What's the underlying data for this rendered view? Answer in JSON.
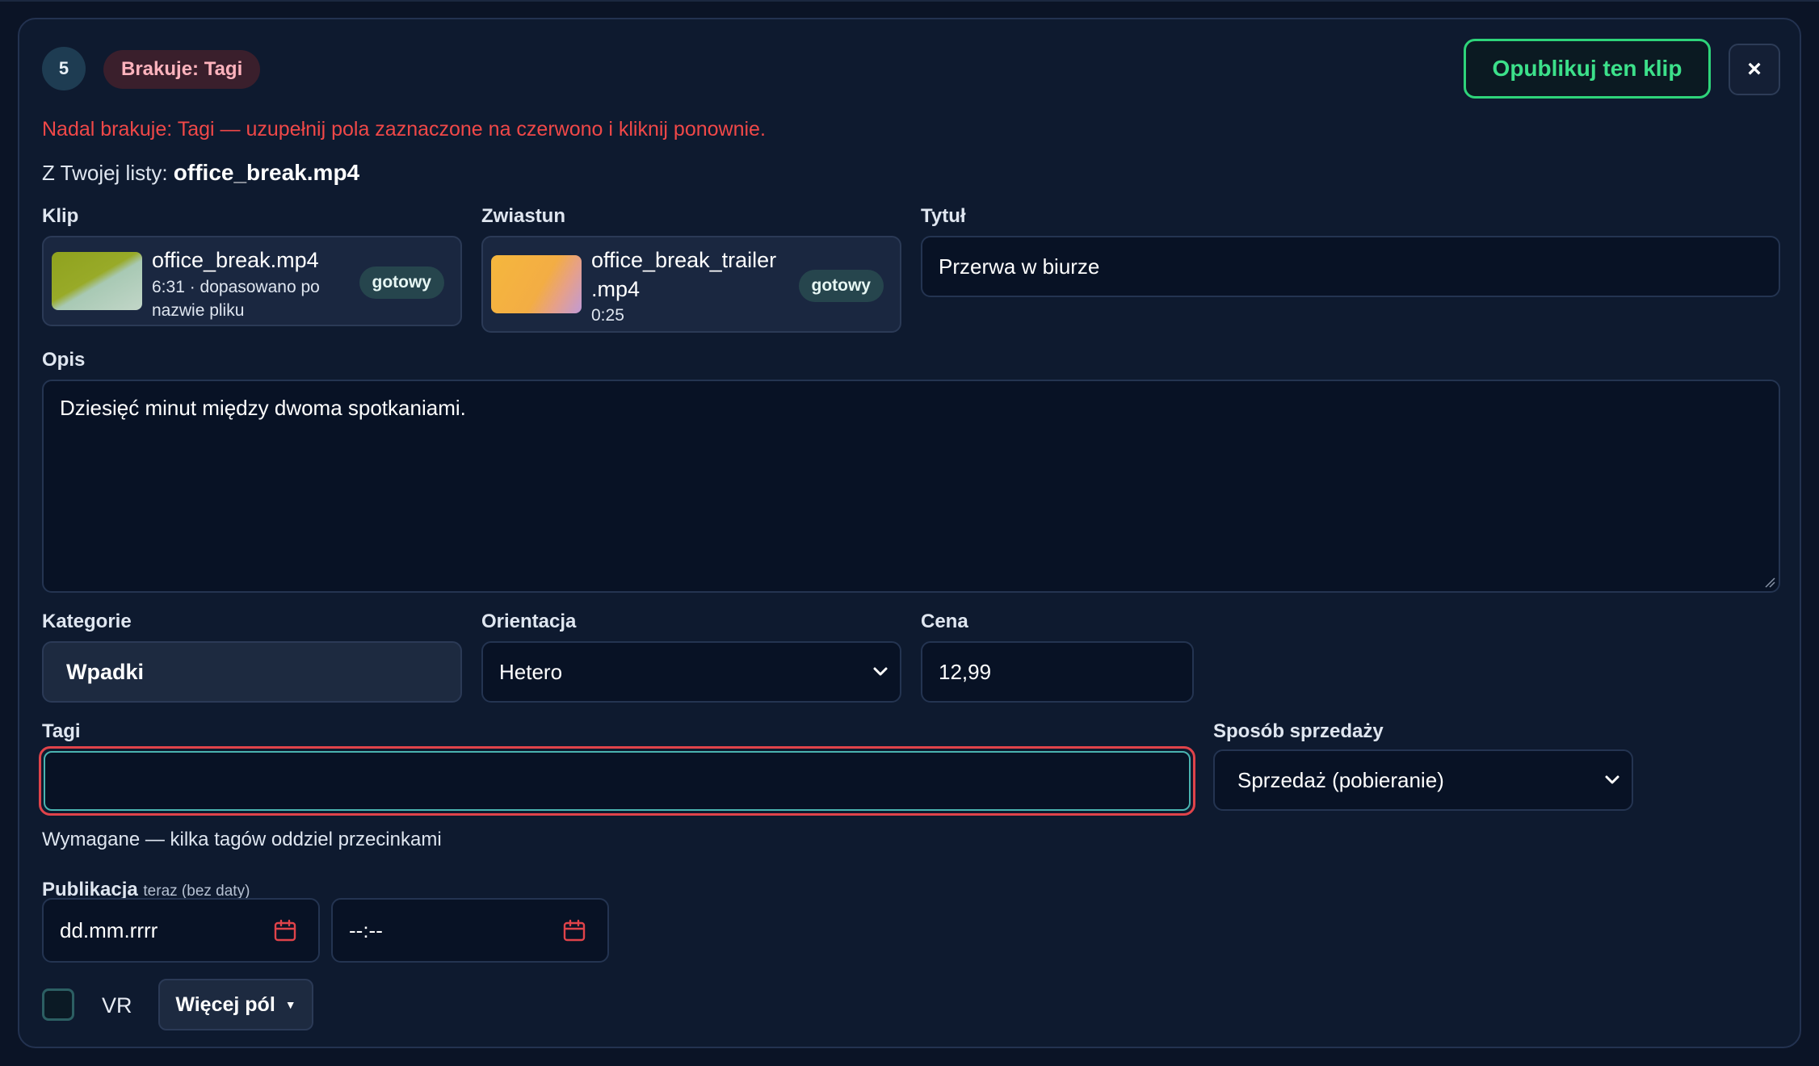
{
  "item": {
    "number": "5",
    "missing_badge": "Brakuje: Tagi"
  },
  "actions": {
    "publish_label": "Opublikuj ten klip",
    "close_label": "×"
  },
  "error_message": "Nadal brakuje: Tagi — uzupełnij pola zaznaczone na czerwono i kliknij ponownie.",
  "source": {
    "prefix": "Z Twojej listy:",
    "filename": "office_break.mp4"
  },
  "clip": {
    "label": "Klip",
    "filename": "office_break.mp4",
    "meta_line1": "6:31 · dopasowano po",
    "meta_line2": "nazwie pliku",
    "status": "gotowy"
  },
  "trailer": {
    "label": "Zwiastun",
    "filename_line1": "office_break_trailer",
    "filename_line2": ".mp4",
    "duration": "0:25",
    "status": "gotowy"
  },
  "title_field": {
    "label": "Tytuł",
    "value": "Przerwa w biurze"
  },
  "description_field": {
    "label": "Opis",
    "value": "Dziesięć minut między dwoma spotkaniami."
  },
  "categories_field": {
    "label": "Kategorie",
    "value": "Wpadki"
  },
  "orientation_field": {
    "label": "Orientacja",
    "selected": "Hetero"
  },
  "price_field": {
    "label": "Cena",
    "value": "12,99"
  },
  "tags_field": {
    "label": "Tagi",
    "value": "",
    "hint": "Wymagane — kilka tagów oddziel przecinkami"
  },
  "sale_mode_field": {
    "label": "Sposób sprzedaży",
    "selected": "Sprzedaż (pobieranie)"
  },
  "publication": {
    "label": "Publikacja",
    "sublabel": "teraz (bez daty)",
    "date_placeholder": "dd.mm.rrrr",
    "time_placeholder": "--:--"
  },
  "vr": {
    "label": "VR",
    "checked": false
  },
  "more_fields": {
    "label": "Więcej pól",
    "caret": "▼"
  },
  "colors": {
    "background": "#0b1426",
    "card": "#0e1a2f",
    "accent_green": "#2ed47a",
    "error_red": "#f04848",
    "tag_badge_bg": "#3a1f2c",
    "ready_pill_bg": "#26454d",
    "icon_red": "#e0434a"
  },
  "icons": {
    "calendar": "calendar-icon",
    "chevron": "chevron-down-icon",
    "close": "close-icon"
  }
}
